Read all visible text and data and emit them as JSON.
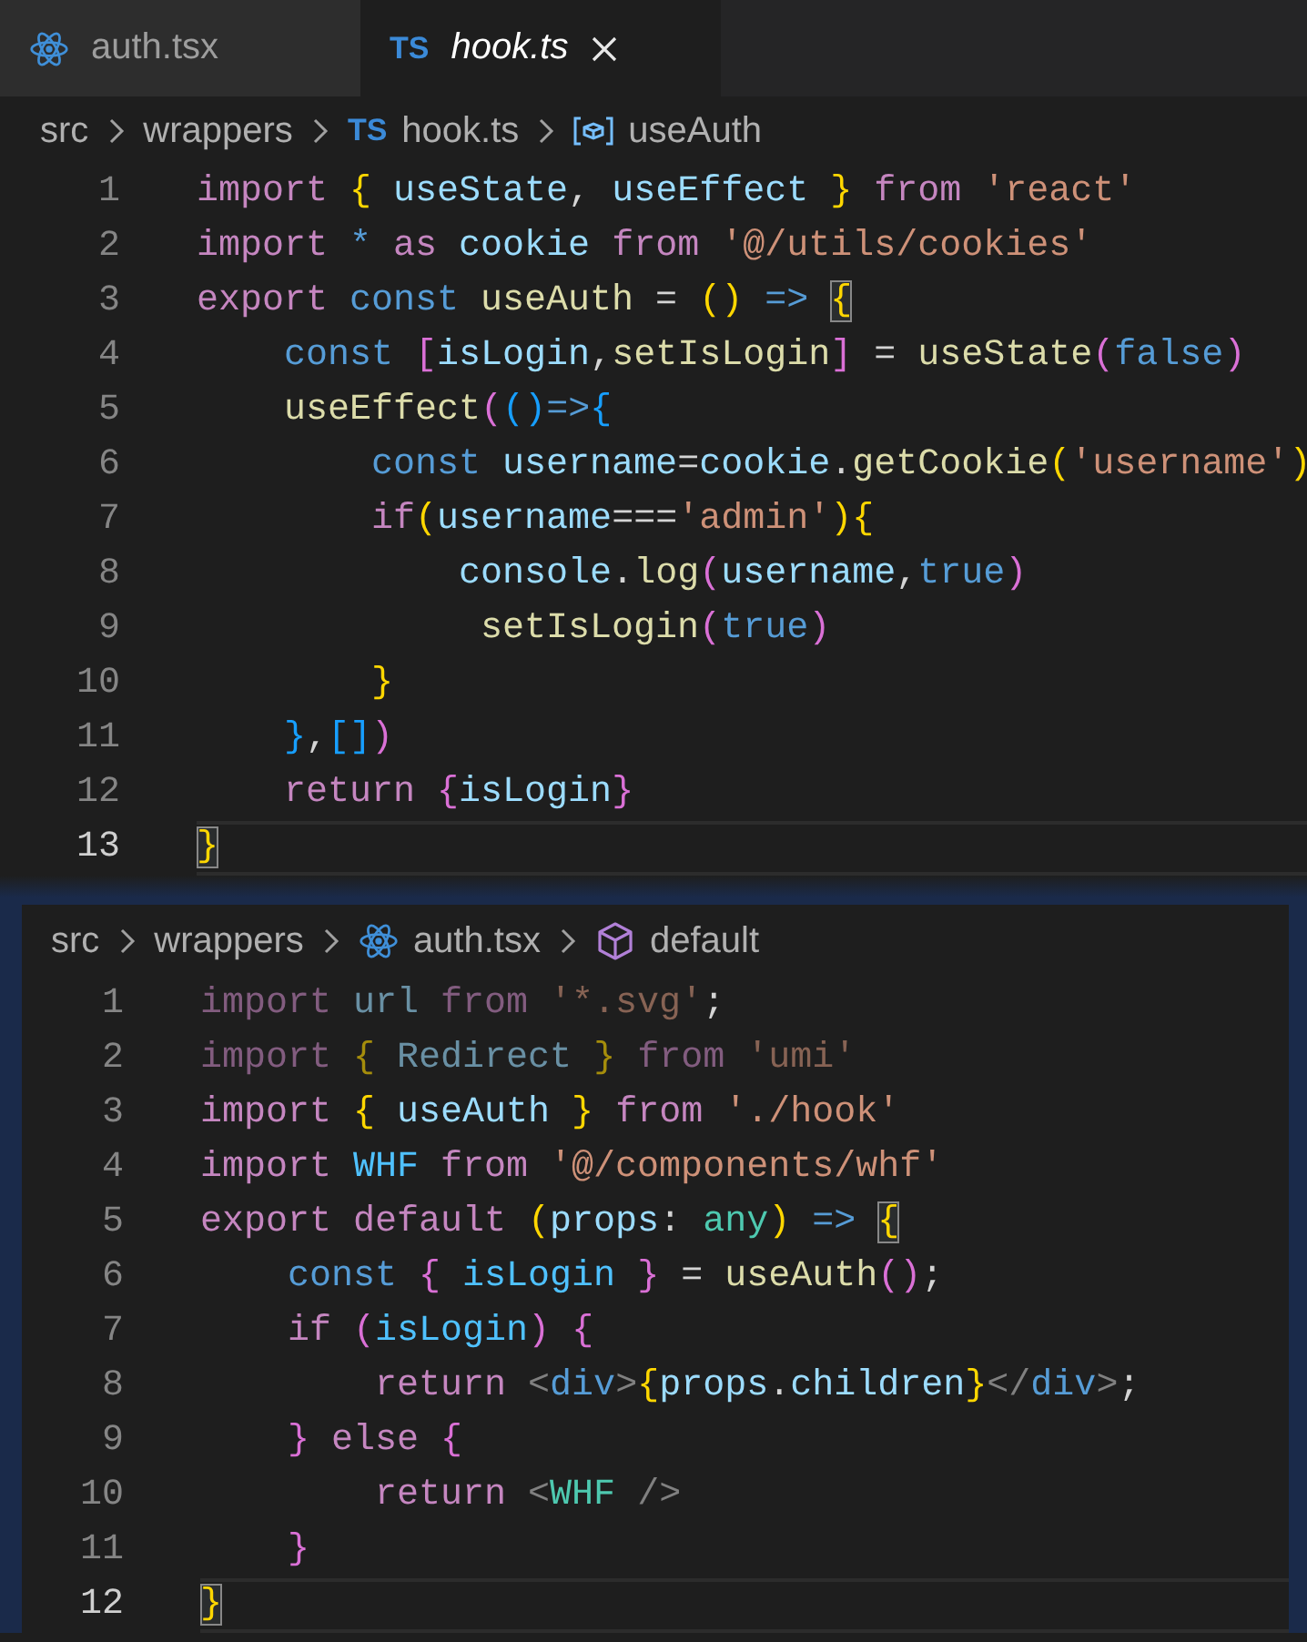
{
  "tabs": [
    {
      "label": "auth.tsx",
      "kind": "react",
      "selected": false,
      "preview": false
    },
    {
      "label": "hook.ts",
      "kind": "ts",
      "badge": "TS",
      "selected": true,
      "preview": true
    }
  ],
  "panes": [
    {
      "focused": false,
      "breadcrumbs": [
        {
          "label": "src",
          "kind": "folder"
        },
        {
          "label": "wrappers",
          "kind": "folder"
        },
        {
          "label": "hook.ts",
          "kind": "ts",
          "badge": "TS"
        },
        {
          "label": "useAuth",
          "kind": "variable"
        }
      ],
      "lines": [
        {
          "number": "1",
          "current": false,
          "tokens": [
            {
              "text": "import",
              "kind": "kw"
            },
            {
              "text": " {",
              "kind": "b1"
            },
            {
              "text": " useState",
              "kind": "var"
            },
            {
              "text": ",",
              "kind": "p"
            },
            {
              "text": " useEffect",
              "kind": "var"
            },
            {
              "text": " }",
              "kind": "b1"
            },
            {
              "text": " from",
              "kind": "kw"
            },
            {
              "text": " 'react'",
              "kind": "str"
            }
          ]
        },
        {
          "number": "2",
          "current": false,
          "tokens": [
            {
              "text": "import",
              "kind": "kw"
            },
            {
              "text": " *",
              "kind": "st"
            },
            {
              "text": " as",
              "kind": "kw"
            },
            {
              "text": " cookie",
              "kind": "var"
            },
            {
              "text": " from",
              "kind": "kw"
            },
            {
              "text": " '@/utils/cookies'",
              "kind": "str"
            }
          ]
        },
        {
          "number": "3",
          "current": false,
          "tokens": [
            {
              "text": "export",
              "kind": "kw"
            },
            {
              "text": " const",
              "kind": "st"
            },
            {
              "text": " useAuth",
              "kind": "fn"
            },
            {
              "text": " = ",
              "kind": "p"
            },
            {
              "text": "()",
              "kind": "b1"
            },
            {
              "text": " => ",
              "kind": "st"
            },
            {
              "text": "{",
              "kind": "b1_m"
            }
          ]
        },
        {
          "number": "4",
          "current": false,
          "tokens": [
            {
              "text": "    const",
              "kind": "st"
            },
            {
              "text": " [",
              "kind": "b2"
            },
            {
              "text": "isLogin",
              "kind": "var"
            },
            {
              "text": ",",
              "kind": "p"
            },
            {
              "text": "setIsLogin",
              "kind": "fn"
            },
            {
              "text": "]",
              "kind": "b2"
            },
            {
              "text": " = ",
              "kind": "p"
            },
            {
              "text": "useState",
              "kind": "fn"
            },
            {
              "text": "(",
              "kind": "b2"
            },
            {
              "text": "false",
              "kind": "st"
            },
            {
              "text": ")",
              "kind": "b2"
            }
          ]
        },
        {
          "number": "5",
          "current": false,
          "tokens": [
            {
              "text": "    useEffect",
              "kind": "fn"
            },
            {
              "text": "(",
              "kind": "b2"
            },
            {
              "text": "()",
              "kind": "b3"
            },
            {
              "text": "=>",
              "kind": "st"
            },
            {
              "text": "{",
              "kind": "b3"
            }
          ]
        },
        {
          "number": "6",
          "current": false,
          "tokens": [
            {
              "text": "        const",
              "kind": "st"
            },
            {
              "text": " username",
              "kind": "var"
            },
            {
              "text": "=",
              "kind": "p"
            },
            {
              "text": "cookie",
              "kind": "var"
            },
            {
              "text": ".",
              "kind": "p"
            },
            {
              "text": "getCookie",
              "kind": "fn"
            },
            {
              "text": "(",
              "kind": "b1"
            },
            {
              "text": "'username'",
              "kind": "str"
            },
            {
              "text": ")",
              "kind": "b1"
            }
          ]
        },
        {
          "number": "7",
          "current": false,
          "tokens": [
            {
              "text": "        if",
              "kind": "kw"
            },
            {
              "text": "(",
              "kind": "b1"
            },
            {
              "text": "username",
              "kind": "var"
            },
            {
              "text": "===",
              "kind": "p"
            },
            {
              "text": "'admin'",
              "kind": "str"
            },
            {
              "text": ")",
              "kind": "b1"
            },
            {
              "text": "{",
              "kind": "b1"
            }
          ]
        },
        {
          "number": "8",
          "current": false,
          "tokens": [
            {
              "text": "            console",
              "kind": "var"
            },
            {
              "text": ".",
              "kind": "p"
            },
            {
              "text": "log",
              "kind": "fn"
            },
            {
              "text": "(",
              "kind": "b2"
            },
            {
              "text": "username",
              "kind": "var"
            },
            {
              "text": ",",
              "kind": "p"
            },
            {
              "text": "true",
              "kind": "st"
            },
            {
              "text": ")",
              "kind": "b2"
            }
          ]
        },
        {
          "number": "9",
          "current": false,
          "tokens": [
            {
              "text": "             setIsLogin",
              "kind": "fn"
            },
            {
              "text": "(",
              "kind": "b2"
            },
            {
              "text": "true",
              "kind": "st"
            },
            {
              "text": ")",
              "kind": "b2"
            }
          ]
        },
        {
          "number": "10",
          "current": false,
          "tokens": [
            {
              "text": "        }",
              "kind": "b1"
            }
          ]
        },
        {
          "number": "11",
          "current": false,
          "tokens": [
            {
              "text": "    }",
              "kind": "b3"
            },
            {
              "text": ",",
              "kind": "p"
            },
            {
              "text": "[]",
              "kind": "b3"
            },
            {
              "text": ")",
              "kind": "b2"
            }
          ]
        },
        {
          "number": "12",
          "current": false,
          "tokens": [
            {
              "text": "    return",
              "kind": "kw"
            },
            {
              "text": " {",
              "kind": "b2"
            },
            {
              "text": "isLogin",
              "kind": "var"
            },
            {
              "text": "}",
              "kind": "b2"
            }
          ]
        },
        {
          "number": "13",
          "current": true,
          "tokens": [
            {
              "text": "}",
              "kind": "b1_m"
            }
          ]
        }
      ]
    },
    {
      "focused": true,
      "breadcrumbs": [
        {
          "label": "src",
          "kind": "folder"
        },
        {
          "label": "wrappers",
          "kind": "folder"
        },
        {
          "label": "auth.tsx",
          "kind": "react"
        },
        {
          "label": "default",
          "kind": "module"
        }
      ],
      "lines": [
        {
          "number": "1",
          "current": false,
          "tokens": [
            {
              "text": "import",
              "kind": "kw_f"
            },
            {
              "text": " url",
              "kind": "var_f"
            },
            {
              "text": " from",
              "kind": "kw_f"
            },
            {
              "text": " '*.svg'",
              "kind": "str_f"
            },
            {
              "text": ";",
              "kind": "p"
            }
          ]
        },
        {
          "number": "2",
          "current": false,
          "tokens": [
            {
              "text": "import",
              "kind": "kw_f"
            },
            {
              "text": " {",
              "kind": "b1_f"
            },
            {
              "text": " Redirect",
              "kind": "var_f"
            },
            {
              "text": " }",
              "kind": "b1_f"
            },
            {
              "text": " from",
              "kind": "kw_f"
            },
            {
              "text": " 'umi'",
              "kind": "str_f"
            }
          ]
        },
        {
          "number": "3",
          "current": false,
          "tokens": [
            {
              "text": "import",
              "kind": "kw"
            },
            {
              "text": " {",
              "kind": "b1"
            },
            {
              "text": " useAuth",
              "kind": "var"
            },
            {
              "text": " }",
              "kind": "b1"
            },
            {
              "text": " from",
              "kind": "kw"
            },
            {
              "text": " './hook'",
              "kind": "str"
            }
          ]
        },
        {
          "number": "4",
          "current": false,
          "tokens": [
            {
              "text": "import",
              "kind": "kw"
            },
            {
              "text": " WHF",
              "kind": "cst"
            },
            {
              "text": " from",
              "kind": "kw"
            },
            {
              "text": " '@/components/whf'",
              "kind": "str"
            }
          ]
        },
        {
          "number": "5",
          "current": false,
          "tokens": [
            {
              "text": "export",
              "kind": "kw"
            },
            {
              "text": " default",
              "kind": "kw"
            },
            {
              "text": " (",
              "kind": "b1"
            },
            {
              "text": "props",
              "kind": "var"
            },
            {
              "text": ":",
              "kind": "p"
            },
            {
              "text": " any",
              "kind": "ty"
            },
            {
              "text": ")",
              "kind": "b1"
            },
            {
              "text": " => ",
              "kind": "st"
            },
            {
              "text": "{",
              "kind": "b1_m"
            }
          ]
        },
        {
          "number": "6",
          "current": false,
          "tokens": [
            {
              "text": "    const",
              "kind": "st"
            },
            {
              "text": " {",
              "kind": "b2"
            },
            {
              "text": " isLogin",
              "kind": "cst"
            },
            {
              "text": " }",
              "kind": "b2"
            },
            {
              "text": " = ",
              "kind": "p"
            },
            {
              "text": "useAuth",
              "kind": "fn"
            },
            {
              "text": "()",
              "kind": "b2"
            },
            {
              "text": ";",
              "kind": "p"
            }
          ]
        },
        {
          "number": "7",
          "current": false,
          "tokens": [
            {
              "text": "    if",
              "kind": "kw"
            },
            {
              "text": " (",
              "kind": "b2"
            },
            {
              "text": "isLogin",
              "kind": "cst"
            },
            {
              "text": ")",
              "kind": "b2"
            },
            {
              "text": " {",
              "kind": "b2"
            }
          ]
        },
        {
          "number": "8",
          "current": false,
          "tokens": [
            {
              "text": "        return",
              "kind": "kw"
            },
            {
              "text": " <",
              "kind": "ang"
            },
            {
              "text": "div",
              "kind": "tag"
            },
            {
              "text": ">",
              "kind": "ang"
            },
            {
              "text": "{",
              "kind": "b1"
            },
            {
              "text": "props",
              "kind": "var"
            },
            {
              "text": ".",
              "kind": "p"
            },
            {
              "text": "children",
              "kind": "var"
            },
            {
              "text": "}",
              "kind": "b1"
            },
            {
              "text": "</",
              "kind": "ang"
            },
            {
              "text": "div",
              "kind": "tag"
            },
            {
              "text": ">",
              "kind": "ang"
            },
            {
              "text": ";",
              "kind": "p"
            }
          ]
        },
        {
          "number": "9",
          "current": false,
          "tokens": [
            {
              "text": "    }",
              "kind": "b2"
            },
            {
              "text": " else",
              "kind": "kw"
            },
            {
              "text": " {",
              "kind": "b2"
            }
          ]
        },
        {
          "number": "10",
          "current": false,
          "tokens": [
            {
              "text": "        return",
              "kind": "kw"
            },
            {
              "text": " <",
              "kind": "ang"
            },
            {
              "text": "WHF",
              "kind": "ty"
            },
            {
              "text": " />",
              "kind": "ang"
            }
          ]
        },
        {
          "number": "11",
          "current": false,
          "tokens": [
            {
              "text": "    }",
              "kind": "b2"
            }
          ]
        },
        {
          "number": "12",
          "current": true,
          "tokens": [
            {
              "text": "}",
              "kind": "b1_m"
            }
          ]
        }
      ]
    }
  ]
}
